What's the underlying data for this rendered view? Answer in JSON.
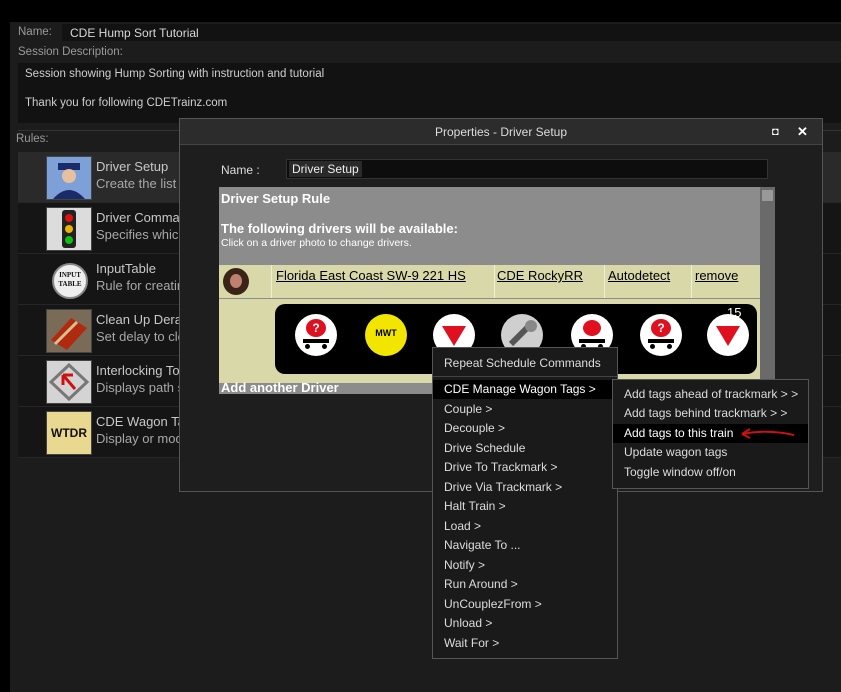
{
  "session": {
    "name_label": "Name:",
    "name_value": "CDE Hump Sort Tutorial",
    "description_label": "Session Description:",
    "description_lines": [
      "Session showing Hump Sorting with instruction and tutorial",
      "Thank you for following CDETrainz.com"
    ],
    "rules_label": "Rules:"
  },
  "rules": [
    {
      "title": "Driver Setup",
      "desc": "Create the list o",
      "icon": "driver-icon"
    },
    {
      "title": "Driver Comman",
      "desc": "Specifies which",
      "icon": "traffic-light-icon"
    },
    {
      "title": "InputTable",
      "desc": "Rule for creatin",
      "icon": "input-table-icon",
      "icon_text_1": "INPUT",
      "icon_text_2": "TABLE"
    },
    {
      "title": "Clean Up Derai",
      "desc": "Set delay to cle",
      "icon": "derailment-icon"
    },
    {
      "title": "Interlocking Tov",
      "desc": "Displays path s",
      "icon": "interlocking-tower-icon"
    },
    {
      "title": "CDE Wagon Ta",
      "desc": "Display or mod",
      "icon": "wtdr-icon",
      "icon_text": "WTDR"
    }
  ],
  "dialog": {
    "title": "Properties - Driver Setup",
    "maximize_symbol": "◘",
    "close_symbol": "✕",
    "name_label": "Name :",
    "name_value": "Driver Setup",
    "rule_heading": "Driver Setup Rule",
    "drivers_heading": "The following drivers will be available:",
    "drivers_hint": "Click on a driver photo to change drivers.",
    "driver_row": {
      "train": "Florida East Coast SW-9 221 HS",
      "author": "CDE RockyRR",
      "mode": "Autodetect",
      "remove": "remove"
    },
    "command_count": "15",
    "mwt_label": "MWT",
    "add_driver": "Add another Driver"
  },
  "menu_main": [
    "Repeat Schedule Commands",
    "CDE Manage Wagon Tags >",
    "Couple >",
    "Decouple >",
    "Drive Schedule",
    "Drive To Trackmark >",
    "Drive Via Trackmark >",
    "Halt Train >",
    "Load >",
    "Navigate To ...",
    "Notify >",
    "Run Around >",
    "UnCouplezFrom >",
    "Unload >",
    "Wait For >"
  ],
  "menu_sub": [
    "Add tags ahead of trackmark > >",
    "Add tags behind trackmark > >",
    "Add tags to this train",
    "Update wagon tags",
    "Toggle window off/on"
  ],
  "colors": {
    "background": "#000000",
    "panel": "#1c1c1c",
    "beige": "#d8d8a8",
    "highlight_arrow": "#cc1111",
    "icon_red": "#e01020",
    "mwt_yellow": "#f2e600"
  }
}
